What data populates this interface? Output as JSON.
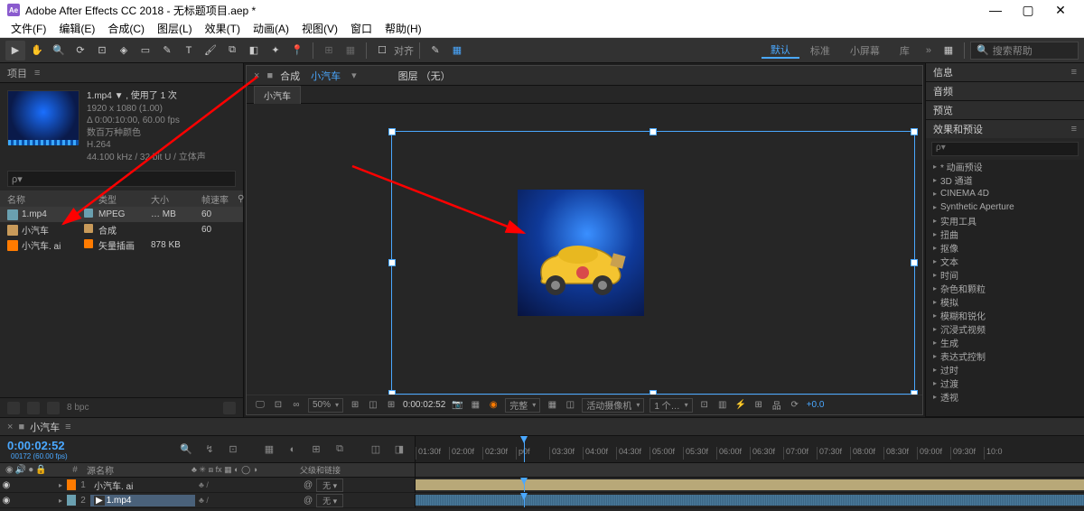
{
  "titlebar": {
    "app_logo": "Ae",
    "title": "Adobe After Effects CC 2018 - 无标题项目.aep *"
  },
  "menubar": [
    "文件(F)",
    "编辑(E)",
    "合成(C)",
    "图层(L)",
    "效果(T)",
    "动画(A)",
    "视图(V)",
    "窗口",
    "帮助(H)"
  ],
  "toolbar": {
    "align_label": "对齐",
    "workspaces": [
      "默认",
      "标准",
      "小屏幕",
      "库"
    ],
    "search_placeholder": "搜索帮助"
  },
  "project": {
    "title": "项目",
    "selected_item_name": "1.mp4 ▼ , 使用了 1 次",
    "metadata": [
      "1920 x 1080 (1.00)",
      "Δ 0:00:10:00, 60.00 fps",
      "数百万种颜色",
      "H.264",
      "44.100 kHz / 32 bit U / 立体声"
    ],
    "search_placeholder": "ρ▾",
    "columns": [
      "名称",
      "",
      "类型",
      "大小",
      "帧速率"
    ],
    "rows": [
      {
        "icon_bg": "#6aa0b0",
        "name": "1.mp4",
        "swatch": "#6aa0b0",
        "type": "MPEG",
        "size": "… MB",
        "fps": "60"
      },
      {
        "icon_bg": "#c89a5a",
        "name": "小汽车",
        "swatch": "#c89a5a",
        "type": "合成",
        "size": "",
        "fps": "60"
      },
      {
        "icon_bg": "#ff7b00",
        "name": "小汽车. ai",
        "swatch": "#ff7b00",
        "type": "矢量插画",
        "size": "878 KB",
        "fps": ""
      }
    ],
    "footer_bpc": "8 bpc"
  },
  "composition": {
    "tab_prefix": "合成",
    "tab_active": "小汽车",
    "layer_tab": "图层 （无）",
    "subtab": "小汽车",
    "footer": {
      "zoom": "50%",
      "timecode": "0:00:02:52",
      "quality": "完整",
      "camera": "活动摄像机",
      "views": "1 个…",
      "exposure": "+0.0"
    }
  },
  "right_panels": {
    "info": "信息",
    "audio": "音频",
    "preview": "预览",
    "effects": "效果和预设",
    "effects_list": [
      "* 动画预设",
      "3D 通道",
      "CINEMA 4D",
      "Synthetic Aperture",
      "实用工具",
      "扭曲",
      "抠像",
      "文本",
      "时间",
      "杂色和颗粒",
      "模拟",
      "模糊和锐化",
      "沉浸式视频",
      "生成",
      "表达式控制",
      "过时",
      "过渡",
      "透视"
    ]
  },
  "timeline": {
    "tab_close": "×",
    "tab_name": "小汽车",
    "current_time": "0:00:02:52",
    "fps_note": "00172 (60.00 fps)",
    "col_hash": "#",
    "col_source": "源名称",
    "col_switches": "♣ ✳ ⧈ fx ▦ ◐ ◯ ◑",
    "col_parent": "父级和链接",
    "ruler_ticks": [
      "01:30f",
      "02:00f",
      "02:30f",
      "p0f",
      "03:30f",
      "04:00f",
      "04:30f",
      "05:00f",
      "05:30f",
      "06:00f",
      "06:30f",
      "07:00f",
      "07:30f",
      "08:00f",
      "08:30f",
      "09:00f",
      "09:30f",
      "10:0"
    ],
    "layers": [
      {
        "eye": "◉",
        "swatch": "#ff7b00",
        "num": "1",
        "name": "小汽车. ai",
        "parent_label": "无",
        "parent_icon": "@"
      },
      {
        "eye": "◉",
        "swatch": "#6aa0b0",
        "num": "2",
        "name": "1.mp4",
        "parent_label": "无",
        "parent_icon": "@"
      }
    ],
    "switch_row": "♣  /"
  }
}
